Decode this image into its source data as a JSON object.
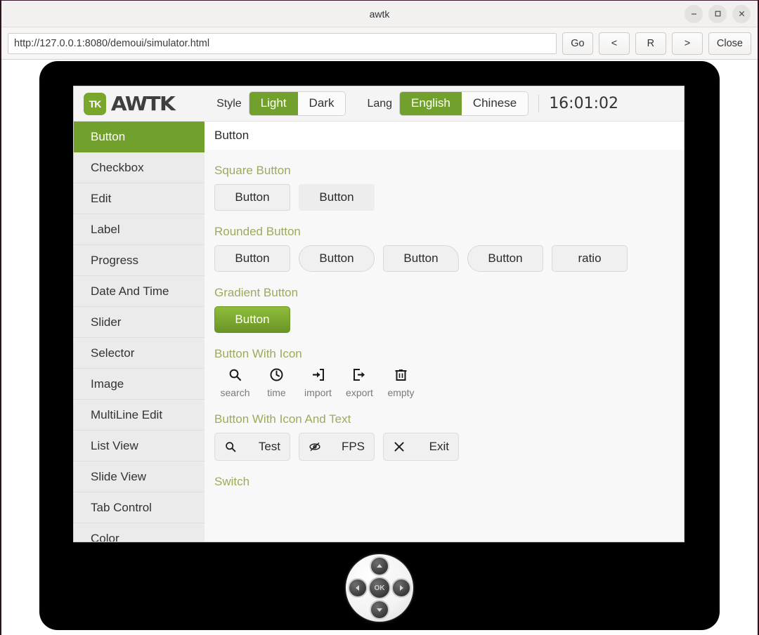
{
  "window": {
    "title": "awtk",
    "minimize_label": "minimize",
    "maximize_label": "maximize",
    "close_label": "close"
  },
  "toolbar": {
    "url_value": "http://127.0.0.1:8080/demoui/simulator.html",
    "url_placeholder": "http://127.0.0.1:8080/demoui/simulator.html",
    "go_label": "Go",
    "back_label": "<",
    "reload_label": "R",
    "forward_label": ">",
    "close_label": "Close"
  },
  "app_header": {
    "logo_badge": "TK",
    "logo_text": "AWTK",
    "style_label": "Style",
    "style_options": [
      "Light",
      "Dark"
    ],
    "style_selected": "Light",
    "lang_label": "Lang",
    "lang_options": [
      "English",
      "Chinese"
    ],
    "lang_selected": "English",
    "clock": "16:01:02",
    "accent_color": "#72a02c"
  },
  "sidebar": {
    "items": [
      {
        "label": "Button",
        "active": true
      },
      {
        "label": "Checkbox",
        "active": false
      },
      {
        "label": "Edit",
        "active": false
      },
      {
        "label": "Label",
        "active": false
      },
      {
        "label": "Progress",
        "active": false
      },
      {
        "label": "Date And Time",
        "active": false
      },
      {
        "label": "Slider",
        "active": false
      },
      {
        "label": "Selector",
        "active": false
      },
      {
        "label": "Image",
        "active": false
      },
      {
        "label": "MultiLine Edit",
        "active": false
      },
      {
        "label": "List View",
        "active": false
      },
      {
        "label": "Slide View",
        "active": false
      },
      {
        "label": "Tab Control",
        "active": false
      },
      {
        "label": "Color",
        "active": false
      }
    ]
  },
  "content": {
    "title": "Button",
    "section_color": "#9bab5d",
    "sections": [
      {
        "heading": "Square Button",
        "buttons": [
          {
            "label": "Button",
            "variant": "square-bordered"
          },
          {
            "label": "Button",
            "variant": "square-borderless"
          }
        ]
      },
      {
        "heading": "Rounded Button",
        "buttons": [
          {
            "label": "Button",
            "variant": "rounded-small"
          },
          {
            "label": "Button",
            "variant": "rounded-pill"
          },
          {
            "label": "Button",
            "variant": "rounded-top-right"
          },
          {
            "label": "Button",
            "variant": "rounded-left-pill"
          },
          {
            "label": "ratio",
            "variant": "rounded-small"
          }
        ]
      },
      {
        "heading": "Gradient Button",
        "buttons": [
          {
            "label": "Button",
            "variant": "gradient"
          }
        ]
      },
      {
        "heading": "Button With Icon",
        "icon_buttons": [
          {
            "caption": "search",
            "icon": "search-icon"
          },
          {
            "caption": "time",
            "icon": "clock-icon"
          },
          {
            "caption": "import",
            "icon": "import-icon"
          },
          {
            "caption": "export",
            "icon": "export-icon"
          },
          {
            "caption": "empty",
            "icon": "trash-icon"
          }
        ]
      },
      {
        "heading": "Button With Icon And Text",
        "icon_text_buttons": [
          {
            "label": "Test",
            "icon": "search-icon"
          },
          {
            "label": "FPS",
            "icon": "eye-off-icon"
          },
          {
            "label": "Exit",
            "icon": "close-icon"
          }
        ]
      },
      {
        "heading": "Switch"
      }
    ]
  },
  "dpad": {
    "ok_label": "OK",
    "up_label": "up",
    "down_label": "down",
    "left_label": "left",
    "right_label": "right"
  }
}
